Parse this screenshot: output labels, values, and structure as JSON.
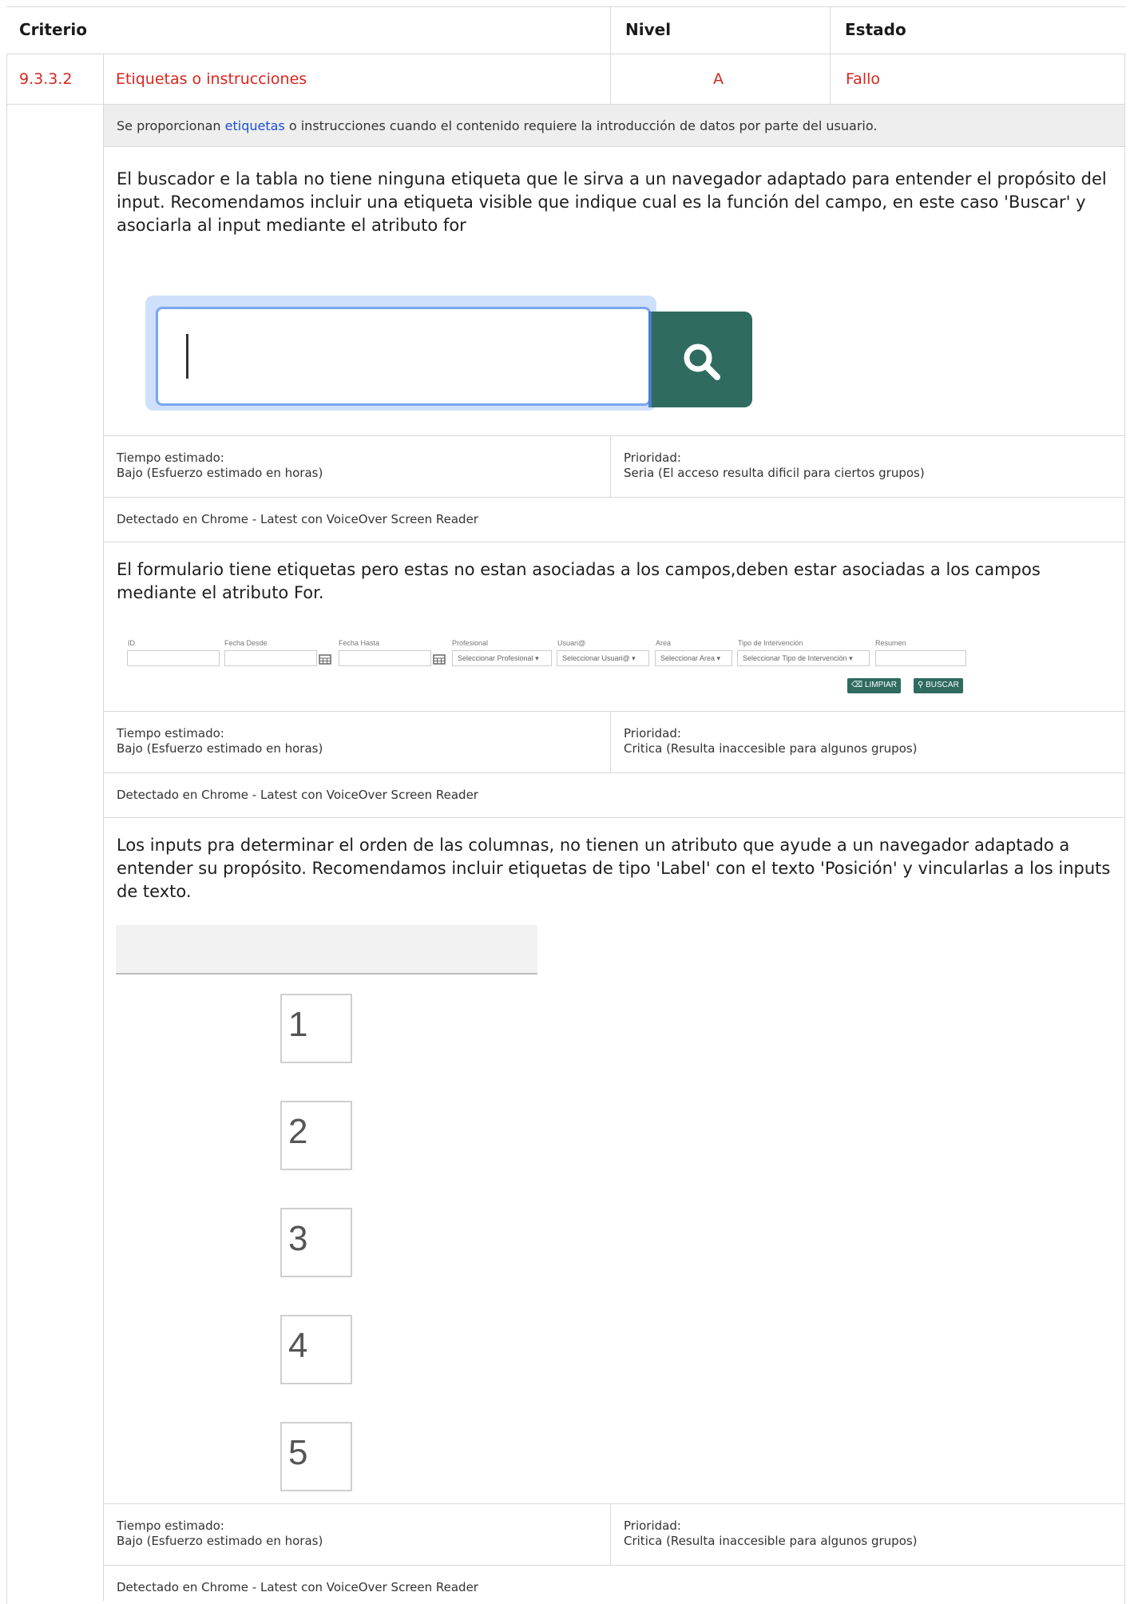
{
  "header": {
    "criterio": "Criterio",
    "nivel": "Nivel",
    "estado": "Estado"
  },
  "criterion": {
    "id": "9.3.3.2",
    "name": "Etiquetas o instrucciones",
    "level": "A",
    "status": "Fallo",
    "status_color": "#d9251d"
  },
  "description": {
    "before": "Se proporcionan ",
    "link": "etiquetas",
    "after": " o instrucciones cuando el contenido requiere la introducción de datos por parte del usuario."
  },
  "findings": [
    {
      "text": "El buscador e la tabla no tiene ninguna etiqueta que le sirva a un navegador adaptado para entender el propósito del input. Recomendamos incluir una etiqueta visible que indique cual es la función del campo, en este caso 'Buscar' y asociarla al input mediante el atributo for",
      "tiempo_label": "Tiempo estimado:",
      "tiempo_value": "Bajo (Esfuerzo estimado en horas)",
      "prioridad_label": "Prioridad:",
      "prioridad_value": "Seria (El acceso resulta dificil para ciertos grupos)",
      "detected": "Detectado en Chrome - Latest con VoiceOver Screen Reader"
    },
    {
      "text": "El formulario tiene etiquetas pero estas no estan asociadas a los campos,deben estar asociadas a los campos mediante el atributo For.",
      "tiempo_label": "Tiempo estimado:",
      "tiempo_value": "Bajo (Esfuerzo estimado en horas)",
      "prioridad_label": "Prioridad:",
      "prioridad_value": "Critica (Resulta inaccesible para algunos grupos)",
      "detected": "Detectado en Chrome - Latest con VoiceOver Screen Reader"
    },
    {
      "text": "Los inputs pra determinar el orden de las columnas, no tienen un atributo que ayude a un navegador adaptado a entender su propósito. Recomendamos incluir etiquetas de tipo 'Label' con el texto 'Posición' y vincularlas a los inputs de texto.",
      "tiempo_label": "Tiempo estimado:",
      "tiempo_value": "Bajo (Esfuerzo estimado en horas)",
      "prioridad_label": "Prioridad:",
      "prioridad_value": "Critica (Resulta inaccesible para algunos grupos)",
      "detected": "Detectado en Chrome - Latest con VoiceOver Screen Reader"
    }
  ],
  "form_mock": {
    "labels": [
      "ID",
      "Fecha Desde",
      "Fecha Hasta",
      "Profesional",
      "Usuari@",
      "Area",
      "Tipo de Intervención",
      "Resumen"
    ],
    "selects": [
      "Seleccionar Profesional",
      "Seleccionar Usuari@",
      "Seleccionar Area",
      "Seleccionar Tipo de Intervención"
    ],
    "btn_clear": "LIMPIAR",
    "btn_search": "BUSCAR"
  },
  "positions": [
    "1",
    "2",
    "3",
    "4",
    "5"
  ]
}
